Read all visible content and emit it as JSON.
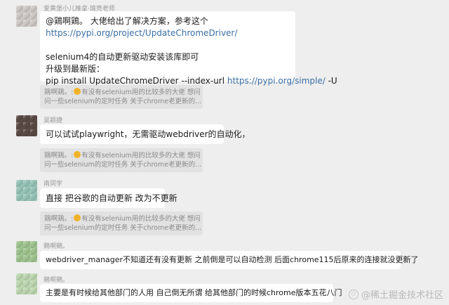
{
  "messages": [
    {
      "sender": "爱黄堡小儿推拿·瑜亮老师",
      "lines": [
        {
          "text": "@鶏啊鶏。 大佬给出了解决方案，参考这个"
        },
        {
          "link": "https://pypi.org/project/UpdateChromeDriver/"
        },
        {
          "text": ""
        },
        {
          "text": "selenium4的自动更新驱动安装该库即可"
        },
        {
          "text": "升级到最新版："
        },
        {
          "text": "pip install UpdateChromeDriver --index-url ",
          "link": "https://pypi.org/simple/",
          "suffix": " -U"
        }
      ],
      "quote": {
        "author": "鶏啊鶏。:",
        "line1": "有没有selenium用的比较多的大佬  想问",
        "line2": "问一些selenium的定时任务  关于chrome老更新的..."
      }
    },
    {
      "sender": "吴颖捷",
      "text": "可以试试playwright，无需驱动webdriver的自动化，",
      "quote": {
        "author": "鶏啊鶏。:",
        "line1": "有没有selenium用的比较多的大佬  想问",
        "line2": "问一些selenium的定时任务  关于chrome老更新的..."
      }
    },
    {
      "sender": "南同学",
      "text": "直接 把谷歌的自动更新 改为不更新",
      "quote": {
        "author": "鶏啊鶏。:",
        "line1": "有没有selenium用的比较多的大佬  想问",
        "line2": "问一些selenium的定时任务  关于chrome老更新的..."
      }
    },
    {
      "sender": "鶏啊鶏。",
      "text": "webdriver_manager不知道还有没有更新   之前倒是可以自动检测  后面chrome115后原来的连接就没更新了"
    },
    {
      "sender": "鶏啊鶏。",
      "text": "主要是有时候给其他部门的人用  自己倒无所谓  给其他部门的时候chrome版本五花八门"
    }
  ],
  "watermark": {
    "icon": "juejin-icon",
    "text": "@稀土掘金技术社区"
  },
  "colors": {
    "link": "#3a6ea5",
    "bubble": "#ffffff",
    "background": "#eeeeee",
    "quote": "#e2e2e2"
  }
}
